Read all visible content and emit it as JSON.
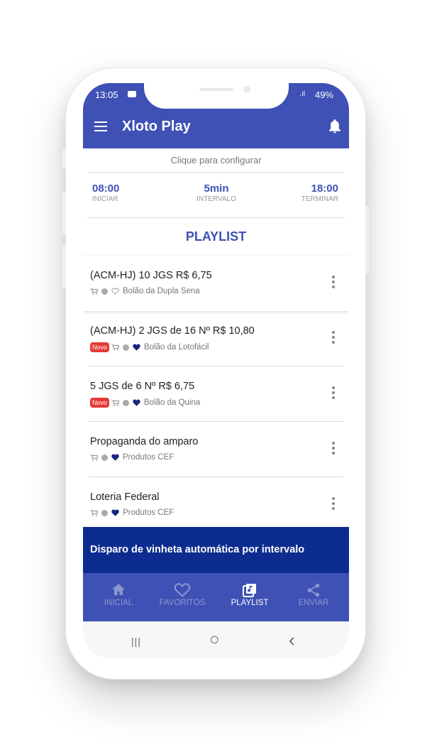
{
  "status": {
    "time": "13:05",
    "signal": ".ıl",
    "battery": "49%"
  },
  "app": {
    "title": "Xloto Play"
  },
  "config": {
    "label": "Clique para configurar"
  },
  "schedule": {
    "start": {
      "value": "08:00",
      "label": "INICIAR"
    },
    "interval": {
      "value": "5min",
      "label": "INTERVALO"
    },
    "end": {
      "value": "18:00",
      "label": "TERMINAR"
    }
  },
  "playlist": {
    "title": "PLAYLIST",
    "items": [
      {
        "title": "(ACM-HJ) 10 JGS R$ 6,75",
        "subtitle": "Bolão da Dupla Sena",
        "badge": "",
        "favorite": false
      },
      {
        "title": "(ACM-HJ) 2 JGS de 16 Nº R$ 10,80",
        "subtitle": "Bolão da Lotofácil",
        "badge": "Novo",
        "favorite": true
      },
      {
        "title": "5 JGS de 6 Nº R$ 6,75",
        "subtitle": "Bolão da Quina",
        "badge": "Novo",
        "favorite": true
      },
      {
        "title": "Propaganda do amparo",
        "subtitle": "Produtos CEF",
        "badge": "",
        "favorite": true
      },
      {
        "title": "Loteria Federal",
        "subtitle": "Produtos CEF",
        "badge": "",
        "favorite": true
      }
    ]
  },
  "banner": {
    "text": "Disparo de vinheta automática por intervalo"
  },
  "nav": {
    "home": "INICIAL",
    "favorites": "FAVORITOS",
    "playlist": "PLAYLIST",
    "send": "ENVIAR",
    "active": "playlist"
  },
  "system_nav": {
    "recents": "|||",
    "home": "○",
    "back": "‹"
  },
  "colors": {
    "primary": "#3f51b5",
    "banner": "#0d2c8f",
    "badge": "#e53935",
    "heart": "#1a237e"
  }
}
